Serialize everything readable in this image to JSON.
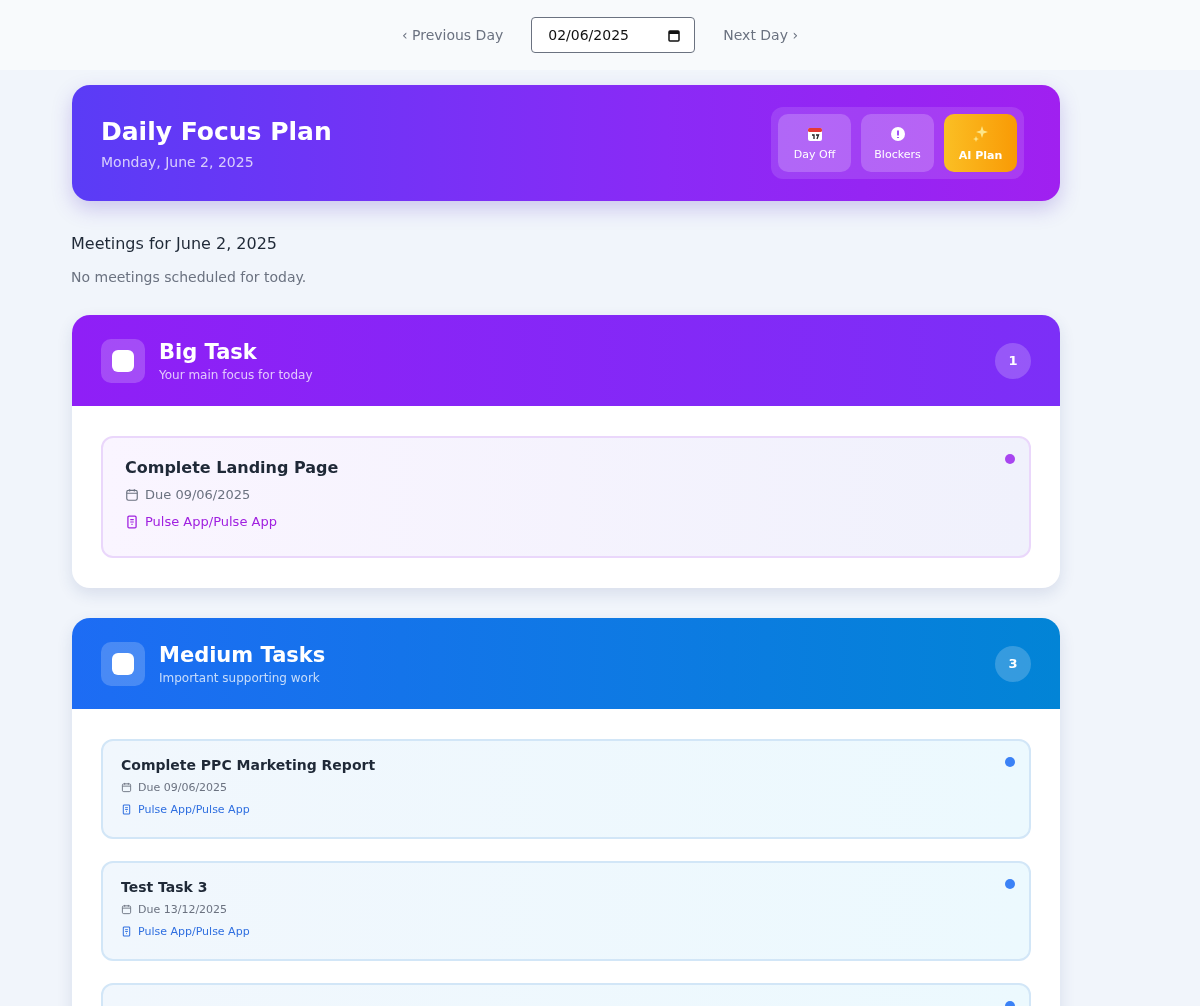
{
  "day_nav": {
    "previous": "‹ Previous Day",
    "date": "02/06/2025",
    "next": "Next Day ›"
  },
  "header": {
    "title": "Daily Focus Plan",
    "date": "Monday, June 2, 2025",
    "actions": [
      {
        "kind": "calendar",
        "label": "Day Off",
        "selected": false
      },
      {
        "kind": "info",
        "label": "Blockers",
        "selected": false
      },
      {
        "kind": "sparkles",
        "label": "AI Plan",
        "selected": true
      }
    ]
  },
  "meetings": {
    "heading": "Meetings for June 2, 2025",
    "empty": "No meetings scheduled for today."
  },
  "sections": [
    {
      "kind": "big",
      "title": "Big Task",
      "subtitle": "Your main focus for today",
      "count": "1",
      "tasks": [
        {
          "title": "Complete Landing Page",
          "due": "Due 09/06/2025",
          "project": "Pulse App/Pulse App",
          "color": "#a845f0"
        }
      ]
    },
    {
      "kind": "medium",
      "title": "Medium Tasks",
      "subtitle": "Important supporting work",
      "count": "3",
      "tasks": [
        {
          "title": "Complete PPC Marketing Report",
          "due": "Due 09/06/2025",
          "project": "Pulse App/Pulse App",
          "color": "#3b82f6"
        },
        {
          "title": "Test Task 3",
          "due": "Due 13/12/2025",
          "project": "Pulse App/Pulse App",
          "color": "#3b82f6"
        },
        {
          "color": "#3b82f6"
        }
      ]
    }
  ]
}
